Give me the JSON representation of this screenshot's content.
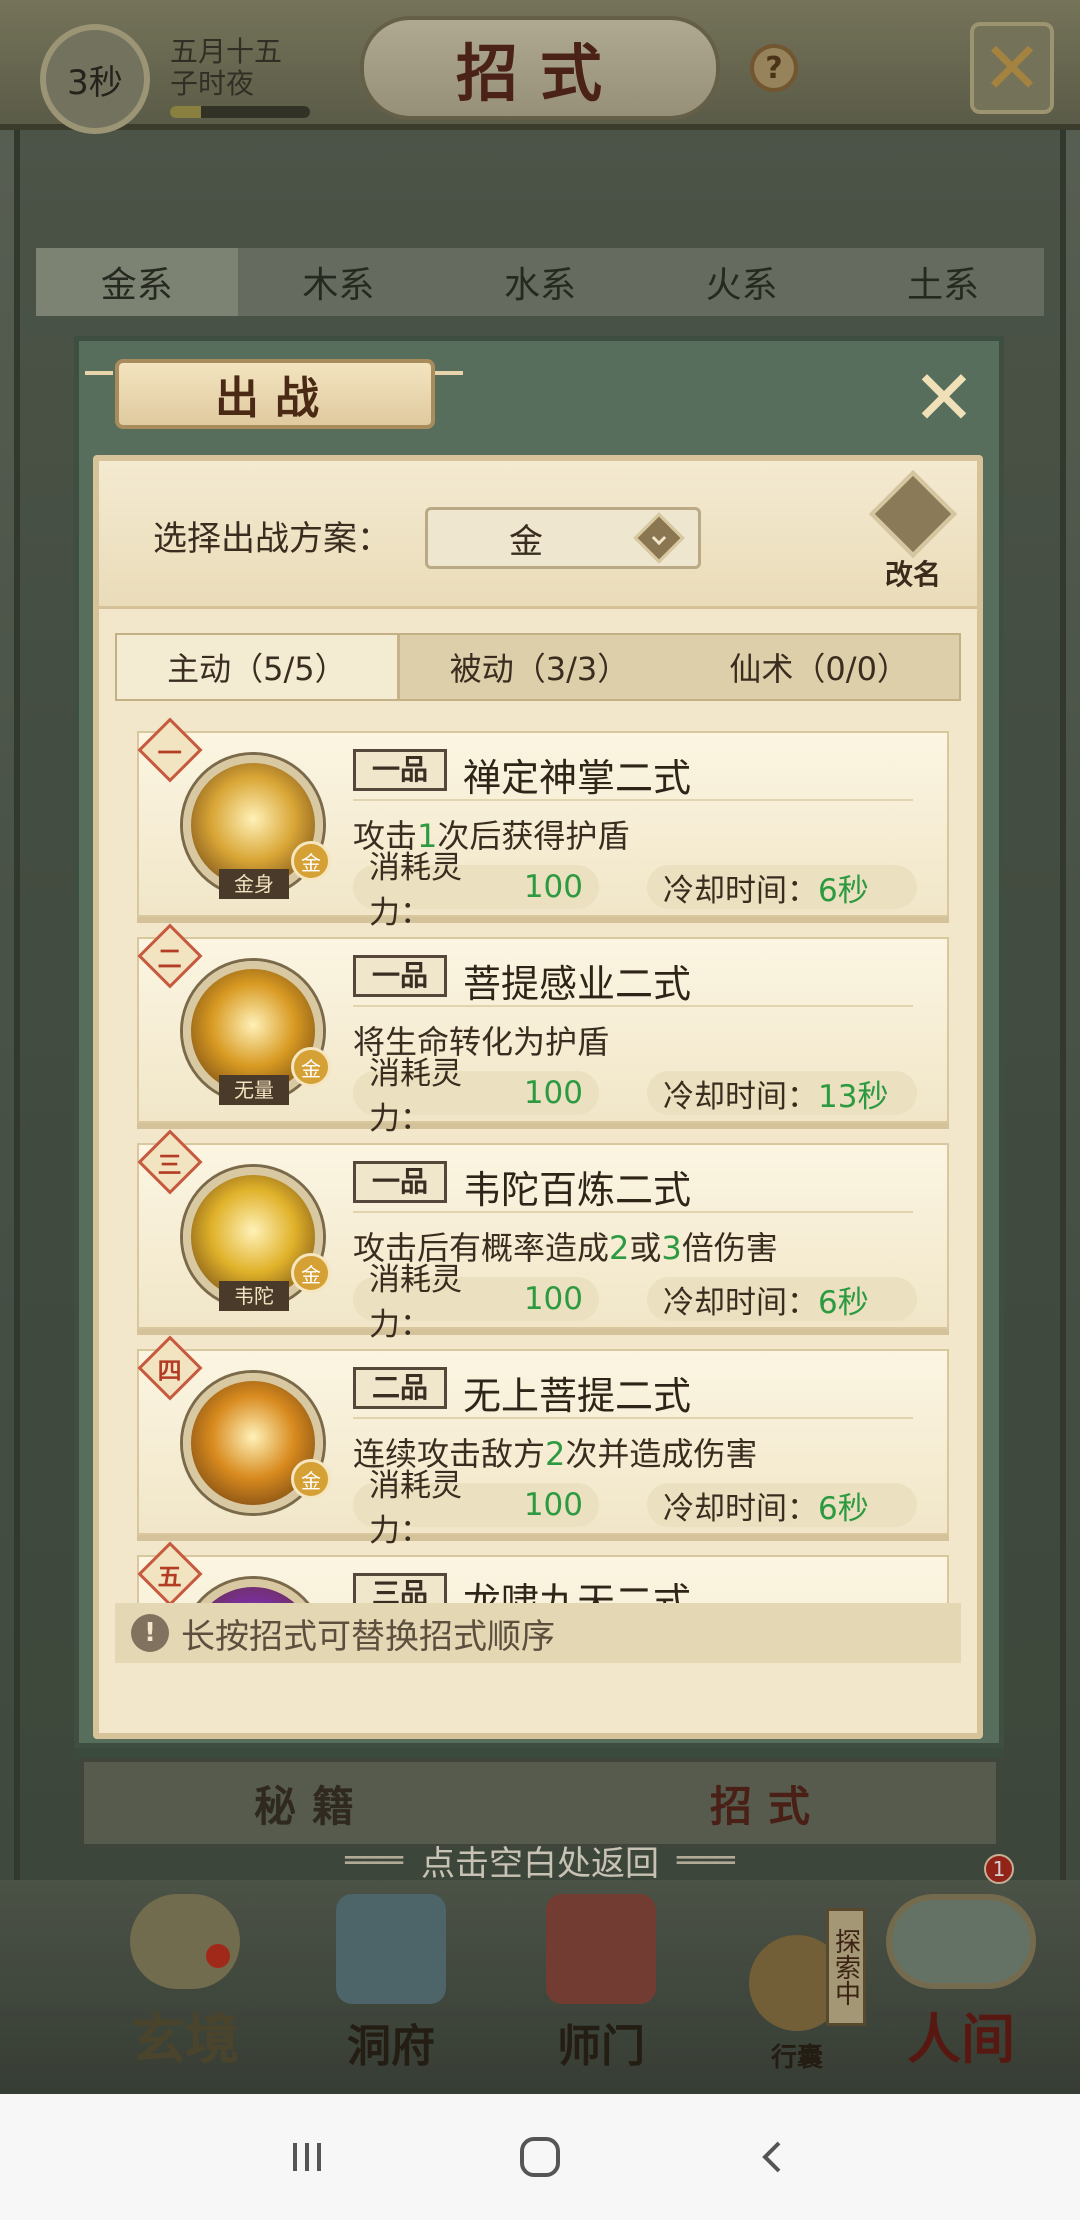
{
  "header": {
    "timer": "3秒",
    "date_line1": "五月十五",
    "date_line2": "子时夜",
    "date_progress": 0.22,
    "title": "招式",
    "help": "?",
    "close_icon": "crossed-swords-icon"
  },
  "element_tabs": [
    {
      "label": "金系",
      "active": true
    },
    {
      "label": "木系",
      "active": false
    },
    {
      "label": "水系",
      "active": false
    },
    {
      "label": "火系",
      "active": false
    },
    {
      "label": "土系",
      "active": false
    }
  ],
  "modal": {
    "title": "出战",
    "close_icon": "crossed-swords-icon",
    "plan_label": "选择出战方案：",
    "plan_value": "金",
    "rename_label": "改名",
    "tabs": [
      {
        "label": "主动（5/5）",
        "active": true
      },
      {
        "label": "被动（3/3）",
        "active": false
      },
      {
        "label": "仙术（0/0）",
        "active": false
      }
    ],
    "skills": [
      {
        "rank": "一",
        "grade": "一品",
        "name": "禅定神掌二式",
        "desc_parts": [
          "攻击",
          "1",
          "次后获得护盾"
        ],
        "icon_label": "金身",
        "element": "金",
        "cost_label": "消耗灵力：",
        "cost_value": "100",
        "cd_label": "冷却时间：",
        "cd_value": "6秒",
        "icon_color": "#d9a636"
      },
      {
        "rank": "二",
        "grade": "一品",
        "name": "菩提感业二式",
        "desc_parts": [
          "将生命转化为护盾"
        ],
        "icon_label": "无量",
        "element": "金",
        "cost_label": "消耗灵力：",
        "cost_value": "100",
        "cd_label": "冷却时间：",
        "cd_value": "13秒",
        "icon_color": "#d89a22"
      },
      {
        "rank": "三",
        "grade": "一品",
        "name": "韦陀百炼二式",
        "desc_parts": [
          "攻击后有概率造成",
          "2",
          "或",
          "3",
          "倍伤害"
        ],
        "icon_label": "韦陀",
        "element": "金",
        "cost_label": "消耗灵力：",
        "cost_value": "100",
        "cd_label": "冷却时间：",
        "cd_value": "6秒",
        "icon_color": "#e0b22a"
      },
      {
        "rank": "四",
        "grade": "二品",
        "name": "无上菩提二式",
        "desc_parts": [
          "连续攻击敌方",
          "2",
          "次并造成伤害"
        ],
        "icon_label": "",
        "element": "金",
        "cost_label": "消耗灵力：",
        "cost_value": "100",
        "cd_label": "冷却时间：",
        "cd_value": "6秒",
        "icon_color": "#d88a1e"
      },
      {
        "rank": "五",
        "grade": "三品",
        "name": "龙啸九天二式",
        "desc_parts": [],
        "icon_label": "",
        "element": "",
        "cost_label": "",
        "cost_value": "",
        "cd_label": "",
        "cd_value": "",
        "icon_color": "#7a2f9a"
      }
    ],
    "hint_icon": "!",
    "hint_text": "长按招式可替换招式顺序"
  },
  "sub_tabs": [
    {
      "label": "秘籍",
      "active": false
    },
    {
      "label": "招式",
      "active": true
    }
  ],
  "tap_hint": "点击空白处返回",
  "bottom_nav": {
    "xuanjing": "玄境",
    "dongfu": "洞府",
    "shimen": "师门",
    "xingnang": "行囊",
    "renjian": "人间",
    "explore_tag": "探索中",
    "renjian_badge": "1"
  },
  "colors": {
    "highlight_green": "#2d9a41",
    "rank_red": "#b23c24",
    "panel_cream": "#f2e7cb",
    "modal_green": "#586e5c"
  }
}
